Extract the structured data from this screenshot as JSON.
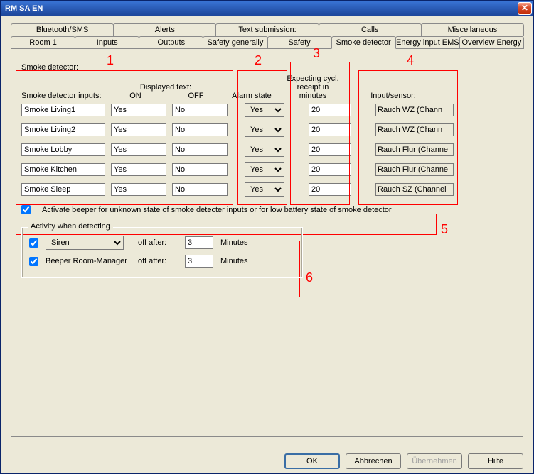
{
  "window": {
    "title": "RM SA EN"
  },
  "tabs_row1": [
    "Bluetooth/SMS",
    "Alerts",
    "Text submission:",
    "Calls",
    "Miscellaneous"
  ],
  "tabs_row2": [
    "Room 1",
    "Inputs",
    "Outputs",
    "Safety generally",
    "Safety",
    "Smoke detector",
    "Energy input EMS",
    "Overview Energy"
  ],
  "active_tab": "Smoke detector",
  "section_label": "Smoke detector:",
  "headers": {
    "inputs": "Smoke detector inputs:",
    "displayed": "Displayed text:",
    "on": "ON",
    "off": "OFF",
    "alarm": "Alarm state",
    "cycl": "Expecting cycl. receipt in minutes",
    "sensor": "Input/sensor:"
  },
  "rows": [
    {
      "name": "Smoke Living1",
      "on": "Yes",
      "off": "No",
      "alarm": "Yes",
      "min": "20",
      "sensor": "Rauch WZ  (Chann"
    },
    {
      "name": "Smoke Living2",
      "on": "Yes",
      "off": "No",
      "alarm": "Yes",
      "min": "20",
      "sensor": "Rauch WZ  (Chann"
    },
    {
      "name": "Smoke Lobby",
      "on": "Yes",
      "off": "No",
      "alarm": "Yes",
      "min": "20",
      "sensor": "Rauch Flur  (Channe"
    },
    {
      "name": "Smoke Kitchen",
      "on": "Yes",
      "off": "No",
      "alarm": "Yes",
      "min": "20",
      "sensor": "Rauch Flur  (Channe"
    },
    {
      "name": "Smoke Sleep",
      "on": "Yes",
      "off": "No",
      "alarm": "Yes",
      "min": "20",
      "sensor": "Rauch SZ  (Channel"
    }
  ],
  "beeper": {
    "checked": true,
    "label": "Activate beeper for unknown state of smoke detecter inputs or for low battery state of smoke detector"
  },
  "activity": {
    "title": "Activity when detecting",
    "siren_checked": true,
    "siren_select": "Siren",
    "off_label": "off after:",
    "siren_min": "3",
    "minutes_label": "Minutes",
    "beeper_checked": true,
    "beeper_label": "Beeper Room-Manager",
    "beeper_min": "3"
  },
  "buttons": {
    "ok": "OK",
    "cancel": "Abbrechen",
    "apply": "Übernehmen",
    "help": "Hilfe"
  },
  "annotations": {
    "n1": "1",
    "n2": "2",
    "n3": "3",
    "n4": "4",
    "n5": "5",
    "n6": "6"
  },
  "chart_data": {
    "type": "table",
    "title": "Smoke detector inputs",
    "columns": [
      "Smoke detector inputs",
      "Displayed text ON",
      "Displayed text OFF",
      "Alarm state",
      "Expecting cycl. receipt in minutes",
      "Input/sensor"
    ],
    "rows": [
      [
        "Smoke Living1",
        "Yes",
        "No",
        "Yes",
        20,
        "Rauch WZ (Chann"
      ],
      [
        "Smoke Living2",
        "Yes",
        "No",
        "Yes",
        20,
        "Rauch WZ (Chann"
      ],
      [
        "Smoke Lobby",
        "Yes",
        "No",
        "Yes",
        20,
        "Rauch Flur (Channe"
      ],
      [
        "Smoke Kitchen",
        "Yes",
        "No",
        "Yes",
        20,
        "Rauch Flur (Channe"
      ],
      [
        "Smoke Sleep",
        "Yes",
        "No",
        "Yes",
        20,
        "Rauch SZ (Channel"
      ]
    ]
  }
}
